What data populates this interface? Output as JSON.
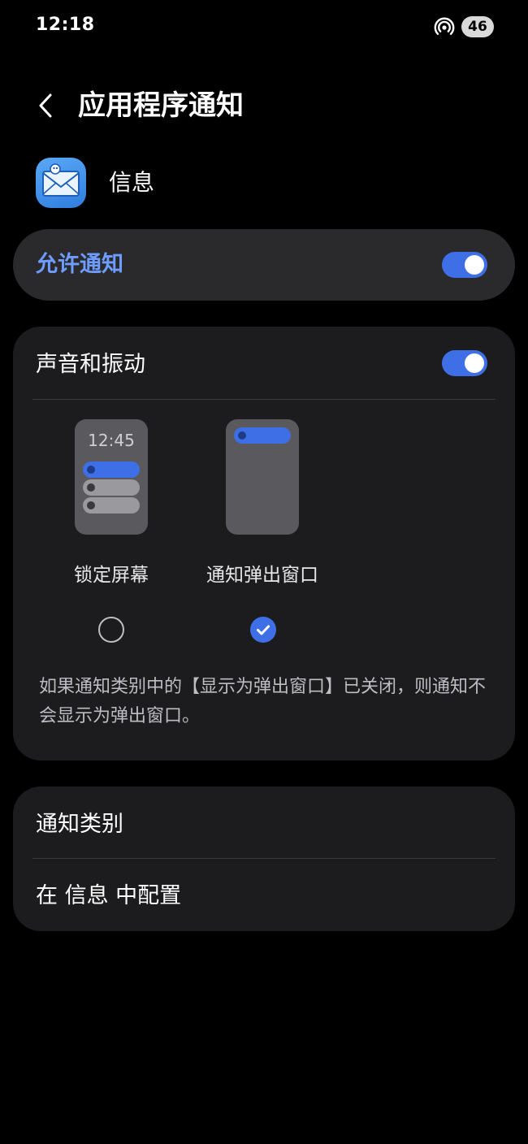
{
  "status_bar": {
    "time": "12:18",
    "battery": "46",
    "icons": [
      "hotspot-icon",
      "battery-icon"
    ]
  },
  "header": {
    "back_icon": "chevron-left-icon",
    "title": "应用程序通知"
  },
  "app": {
    "name": "信息",
    "icon": "messages-app-icon"
  },
  "allow_notifications": {
    "label": "允许通知",
    "enabled": true
  },
  "sound_vibration": {
    "label": "声音和振动",
    "enabled": true,
    "styles": [
      {
        "label": "锁定屏幕",
        "preview_time": "12:45",
        "selected": false
      },
      {
        "label": "通知弹出窗口",
        "selected": true
      }
    ],
    "note": "如果通知类别中的【显示为弹出窗口】已关闭，则通知不会显示为弹出窗口。"
  },
  "categories": {
    "item1": "通知类别",
    "item2": "在 信息 中配置"
  },
  "colors": {
    "accent": "#3f6fe6",
    "accent_text": "#6e9cff",
    "card": "#1c1c1f",
    "background": "#000000"
  }
}
